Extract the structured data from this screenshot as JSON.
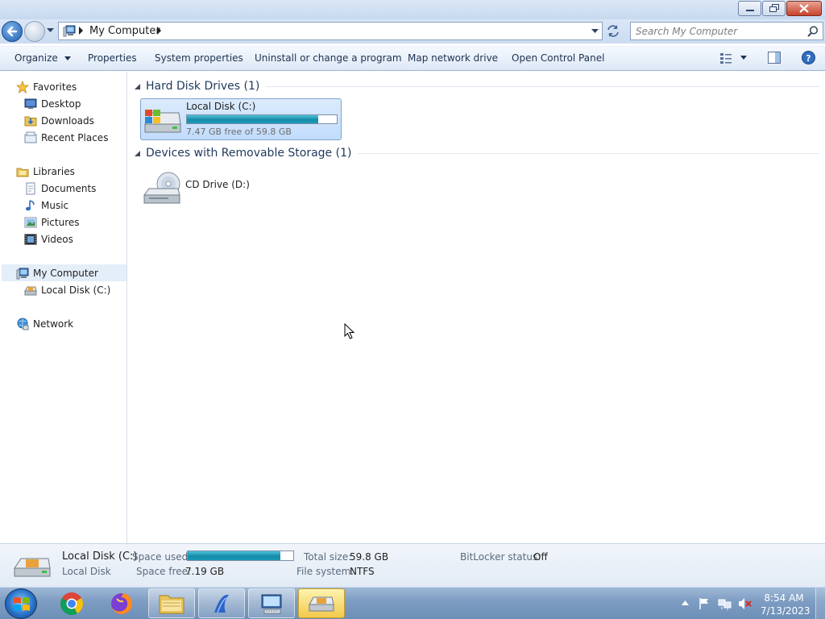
{
  "window": {
    "minimize_icon": "minimize-icon",
    "maximize_icon": "restore-icon",
    "close_icon": "close-icon"
  },
  "address": {
    "crumb": "My Computer",
    "search_placeholder": "Search My Computer"
  },
  "toolbar": {
    "organize": "Organize",
    "properties": "Properties",
    "system_properties": "System properties",
    "uninstall": "Uninstall or change a program",
    "map_drive": "Map network drive",
    "control_panel": "Open Control Panel"
  },
  "nav": {
    "favorites": "Favorites",
    "desktop": "Desktop",
    "downloads": "Downloads",
    "recent": "Recent Places",
    "libraries": "Libraries",
    "documents": "Documents",
    "music": "Music",
    "pictures": "Pictures",
    "videos": "Videos",
    "computer": "My Computer",
    "local_disk": "Local Disk (C:)",
    "network": "Network"
  },
  "content": {
    "hdd_group": "Hard Disk Drives (1)",
    "removable_group": "Devices with Removable Storage (1)",
    "drive_c": {
      "name": "Local Disk (C:)",
      "free_text": "7.47 GB free of 59.8 GB",
      "used_fraction": 0.875
    },
    "drive_d": {
      "name": "CD Drive (D:)"
    }
  },
  "details": {
    "name": "Local Disk (C:)",
    "type": "Local Disk",
    "space_used_label": "Space used:",
    "space_free_label": "Space free:",
    "space_free_value": "7.19 GB",
    "total_size_label": "Total size:",
    "total_size_value": "59.8 GB",
    "file_system_label": "File system:",
    "file_system_value": "NTFS",
    "bitlocker_label": "BitLocker status:",
    "bitlocker_value": "Off",
    "used_fraction": 0.88
  },
  "taskbar": {
    "time": "8:54 AM",
    "date": "7/13/2023"
  }
}
